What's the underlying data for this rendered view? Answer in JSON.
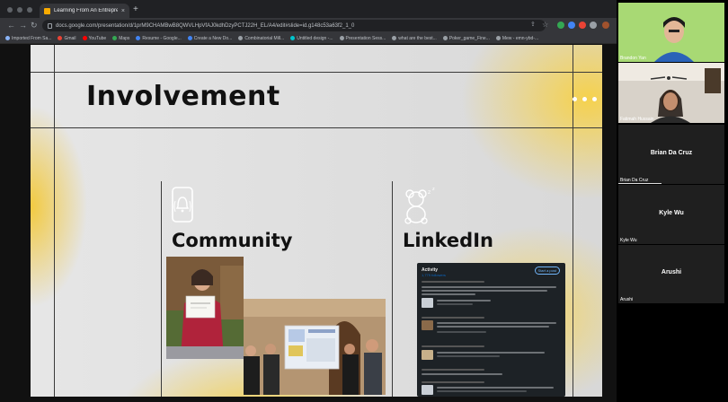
{
  "browser": {
    "tab_title": "Learning From An Entreprene...",
    "tab_close": "×",
    "new_tab": "+",
    "url": "docs.google.com/presentation/d/1prM9CHAMBwB8QWVLHpVfAJ0kdhDzyPCTJ22H_EL/A4/edit#slide=id.g148c53a63f2_1_0",
    "bookmarks": [
      {
        "label": "Imported From Sa...",
        "color": "#8ab4f8"
      },
      {
        "label": "Gmail",
        "color": "#ea4335"
      },
      {
        "label": "YouTube",
        "color": "#ff0000"
      },
      {
        "label": "Maps",
        "color": "#34a853"
      },
      {
        "label": "Resume - Google...",
        "color": "#4285f4"
      },
      {
        "label": "Create a New Do...",
        "color": "#4285f4"
      },
      {
        "label": "Combinatorial Mill...",
        "color": "#9aa0a6"
      },
      {
        "label": "Untitled design -...",
        "color": "#00c4cc"
      },
      {
        "label": "Presentation Sess...",
        "color": "#9aa0a6"
      },
      {
        "label": "what are the best...",
        "color": "#9aa0a6"
      },
      {
        "label": "Poker_game_Fine...",
        "color": "#9aa0a6"
      },
      {
        "label": "Mew - emn-ybd-...",
        "color": "#9aa0a6"
      }
    ]
  },
  "slide": {
    "title": "Involvement",
    "col1_heading": "Community",
    "col2_heading": "LinkedIn",
    "linkedin_card": {
      "heading": "Activity",
      "followers": "1,779 followers",
      "button": "Start a post"
    }
  },
  "participants": [
    {
      "name": "Brandon Yan",
      "has_video": true
    },
    {
      "name": "Fatimah Hussain",
      "has_video": true
    },
    {
      "name": "Brian Da Cruz",
      "has_video": false
    },
    {
      "name": "Kyle Wu",
      "has_video": false
    },
    {
      "name": "Arushi",
      "has_video": false
    }
  ],
  "colors": {
    "accent_yellow": "#f6ce3c",
    "slide_gray": "#dedede",
    "browser_dark": "#202124",
    "linkedin_bg": "#1d2226"
  }
}
